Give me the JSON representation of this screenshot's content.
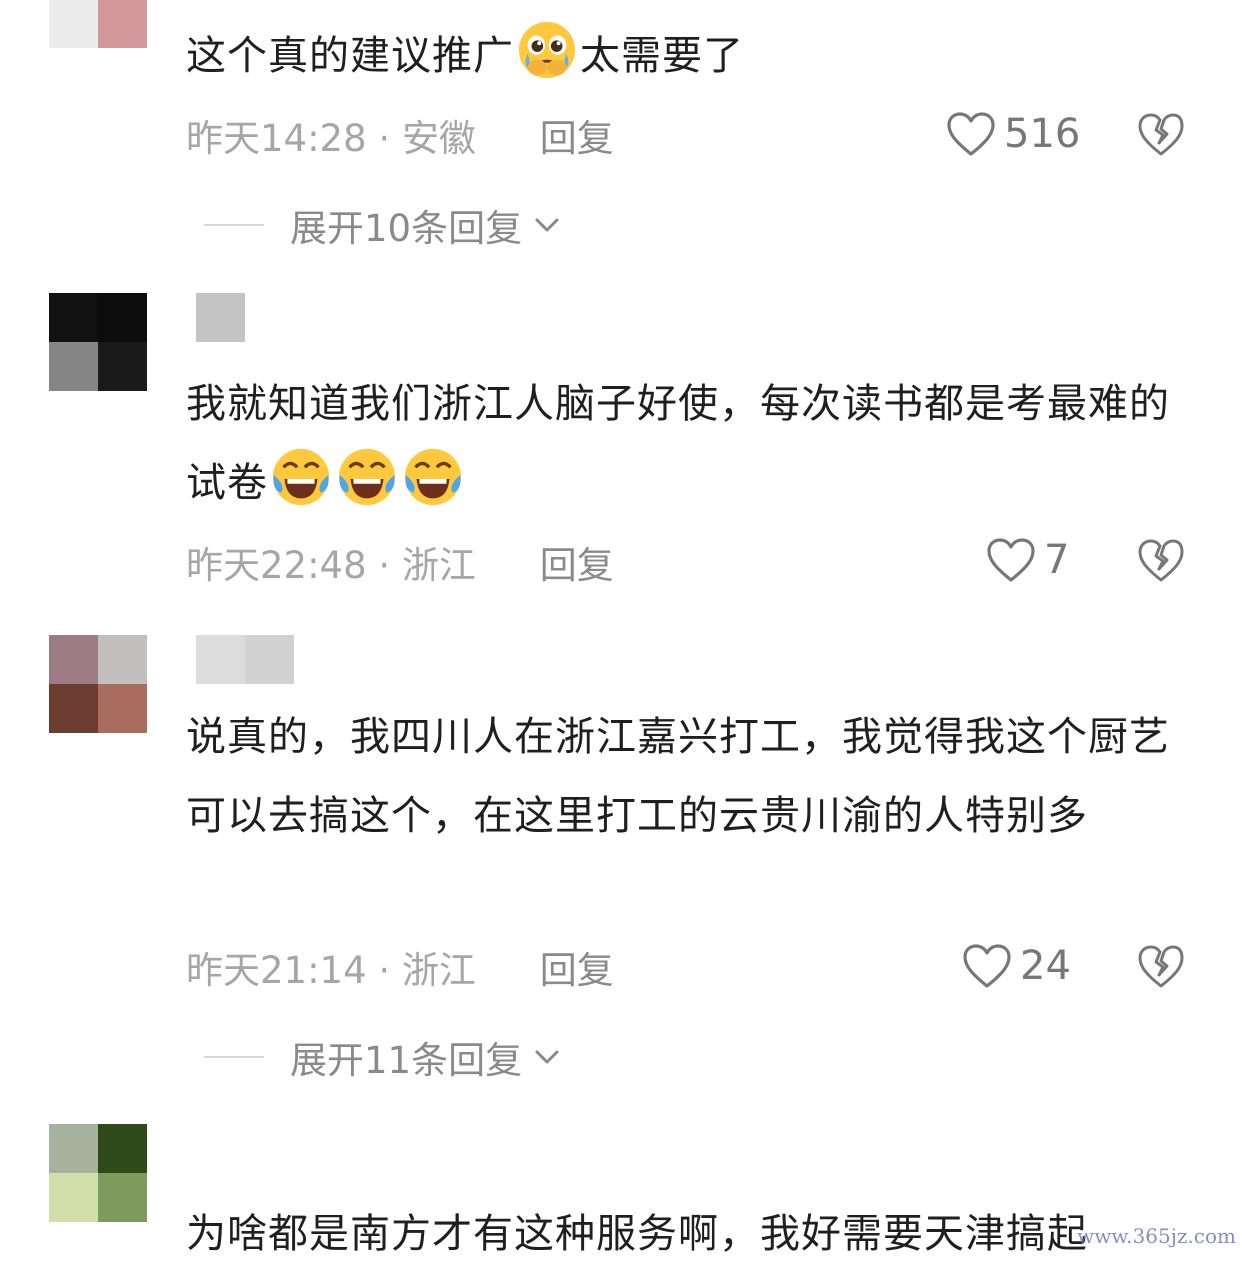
{
  "comments": [
    {
      "text_before": "这个真的建议推广",
      "emoji": "pleading-face-icon",
      "text_after": "太需要了",
      "time": "昨天14:28",
      "location": "安徽",
      "reply_label": "回复",
      "likes": "516",
      "expand_label": "展开10条回复"
    },
    {
      "text": "我就知道我们浙江人脑子好使，每次读书都是考最难的试卷",
      "emoji": "tears-of-joy-icon",
      "time": "昨天22:48",
      "location": "浙江",
      "reply_label": "回复",
      "likes": "7"
    },
    {
      "text": "说真的，我四川人在浙江嘉兴打工，我觉得我这个厨艺可以去搞这个，在这里打工的云贵川渝的人特别多",
      "time": "昨天21:14",
      "location": "浙江",
      "reply_label": "回复",
      "likes": "24",
      "expand_label": "展开11条回复"
    },
    {
      "text": "为啥都是南方才有这种服务啊，我好需要天津搞起"
    }
  ],
  "separator": "·",
  "watermark": "www.365jz.com",
  "colors": {
    "text": "#1f1f1f",
    "meta": "#a6a6a6",
    "reply": "#8a8a8a",
    "icon": "#777777"
  }
}
